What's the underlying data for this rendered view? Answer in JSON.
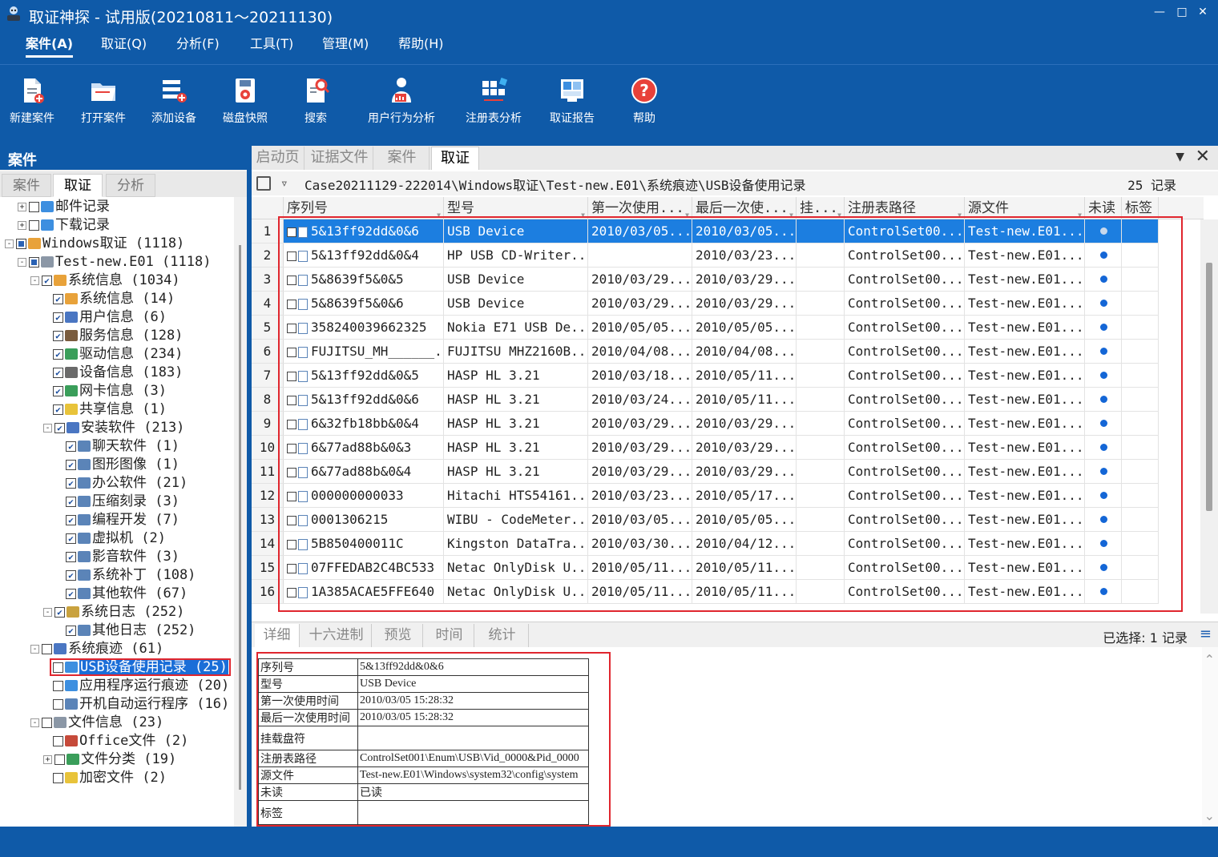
{
  "window": {
    "title": "取证神探 - 试用版(20210811～20211130)",
    "controls": [
      "minimize-icon",
      "maximize-icon",
      "close-icon"
    ]
  },
  "menu": [
    {
      "label": "案件(A)",
      "active": true
    },
    {
      "label": "取证(Q)"
    },
    {
      "label": "分析(F)"
    },
    {
      "label": "工具(T)"
    },
    {
      "label": "管理(M)"
    },
    {
      "label": "帮助(H)"
    }
  ],
  "toolbar": [
    {
      "label": "新建案件",
      "icon": "new-case-icon"
    },
    {
      "label": "打开案件",
      "icon": "open-folder-icon"
    },
    {
      "label": "添加设备",
      "icon": "add-device-icon"
    },
    {
      "label": "磁盘快照",
      "icon": "disk-snapshot-icon"
    },
    {
      "label": "搜索",
      "icon": "search-doc-icon"
    },
    {
      "label": "用户行为分析",
      "icon": "user-analysis-icon"
    },
    {
      "label": "注册表分析",
      "icon": "registry-icon"
    },
    {
      "label": "取证报告",
      "icon": "report-icon"
    },
    {
      "label": "帮助",
      "icon": "help-icon"
    }
  ],
  "left_panel": {
    "title": "案件",
    "tabs": [
      "案件",
      "取证",
      "分析"
    ],
    "active_tab": 1,
    "tree": [
      {
        "exp": "+",
        "chk": "none",
        "label": "邮件记录",
        "icon": "mail-icon"
      },
      {
        "exp": "+",
        "chk": "none",
        "label": "下载记录",
        "icon": "download-icon"
      },
      {
        "exp": "-",
        "chk": "part",
        "label": "Windows取证 (1118)",
        "icon": "windows-icon"
      },
      {
        "exp": "-",
        "chk": "part",
        "label": "Test-new.E01 (1118)",
        "icon": "disk-icon"
      },
      {
        "exp": "-",
        "chk": "check",
        "label": "系统信息 (1034)",
        "icon": "windows-icon"
      },
      {
        "exp": "",
        "chk": "check",
        "label": "系统信息 (14)",
        "icon": "windows-icon"
      },
      {
        "exp": "",
        "chk": "check",
        "label": "用户信息 (6)",
        "icon": "users-icon"
      },
      {
        "exp": "",
        "chk": "check",
        "label": "服务信息 (128)",
        "icon": "service-icon"
      },
      {
        "exp": "",
        "chk": "check",
        "label": "驱动信息 (234)",
        "icon": "driver-icon"
      },
      {
        "exp": "",
        "chk": "check",
        "label": "设备信息 (183)",
        "icon": "device-icon"
      },
      {
        "exp": "",
        "chk": "check",
        "label": "网卡信息 (3)",
        "icon": "nic-icon"
      },
      {
        "exp": "",
        "chk": "check",
        "label": "共享信息 (1)",
        "icon": "share-icon"
      },
      {
        "exp": "-",
        "chk": "check",
        "label": "安装软件 (213)",
        "icon": "software-icon"
      },
      {
        "exp": "",
        "chk": "check",
        "label": "聊天软件 (1)",
        "icon": "file-icon"
      },
      {
        "exp": "",
        "chk": "check",
        "label": "图形图像 (1)",
        "icon": "file-icon"
      },
      {
        "exp": "",
        "chk": "check",
        "label": "办公软件 (21)",
        "icon": "file-icon"
      },
      {
        "exp": "",
        "chk": "check",
        "label": "压缩刻录 (3)",
        "icon": "file-icon"
      },
      {
        "exp": "",
        "chk": "check",
        "label": "编程开发 (7)",
        "icon": "file-icon"
      },
      {
        "exp": "",
        "chk": "check",
        "label": "虚拟机 (2)",
        "icon": "file-icon"
      },
      {
        "exp": "",
        "chk": "check",
        "label": "影音软件 (3)",
        "icon": "file-icon"
      },
      {
        "exp": "",
        "chk": "check",
        "label": "系统补丁 (108)",
        "icon": "file-icon"
      },
      {
        "exp": "",
        "chk": "check",
        "label": "其他软件 (67)",
        "icon": "file-icon"
      },
      {
        "exp": "-",
        "chk": "check",
        "label": "系统日志 (252)",
        "icon": "log-icon"
      },
      {
        "exp": "",
        "chk": "check",
        "label": "其他日志 (252)",
        "icon": "file-icon"
      },
      {
        "exp": "-",
        "chk": "none",
        "label": "系统痕迹 (61)",
        "icon": "trace-icon"
      },
      {
        "exp": "",
        "chk": "none",
        "label": "USB设备使用记录 (25)",
        "icon": "usb-icon",
        "selected": true
      },
      {
        "exp": "",
        "chk": "none",
        "label": "应用程序运行痕迹 (20)",
        "icon": "app-icon"
      },
      {
        "exp": "",
        "chk": "none",
        "label": "开机自动运行程序 (16)",
        "icon": "startup-icon"
      },
      {
        "exp": "-",
        "chk": "none",
        "label": "文件信息 (23)",
        "icon": "files-icon"
      },
      {
        "exp": "",
        "chk": "none",
        "label": "Office文件 (2)",
        "icon": "office-icon"
      },
      {
        "exp": "+",
        "chk": "none",
        "label": "文件分类 (19)",
        "icon": "category-icon"
      },
      {
        "exp": "",
        "chk": "none",
        "label": "加密文件 (2)",
        "icon": "lock-icon"
      }
    ]
  },
  "doc_tabs": [
    "启动页",
    "证据文件",
    "案件",
    "取证"
  ],
  "doc_tab_active": 3,
  "path": {
    "text": "Case20211129-222014\\Windows取证\\Test-new.E01\\系统痕迹\\USB设备使用记录",
    "count": "25 记录"
  },
  "grid": {
    "columns": [
      "序列号",
      "型号",
      "第一次使用...",
      "最后一次使...",
      "挂...",
      "注册表路径",
      "源文件",
      "未读",
      "标签"
    ],
    "rows": [
      {
        "n": "1",
        "serial": "5&13ff92dd&0&6",
        "model": "USB Device",
        "first": "2010/03/05...",
        "last": "2010/03/05...",
        "reg": "ControlSet00...",
        "src": "Test-new.E01...",
        "selected": true
      },
      {
        "n": "2",
        "serial": "5&13ff92dd&0&4",
        "model": "HP USB CD-Writer...",
        "first": "",
        "last": "2010/03/23...",
        "reg": "ControlSet00...",
        "src": "Test-new.E01..."
      },
      {
        "n": "3",
        "serial": "5&8639f5&0&5",
        "model": "USB Device",
        "first": "2010/03/29...",
        "last": "2010/03/29...",
        "reg": "ControlSet00...",
        "src": "Test-new.E01..."
      },
      {
        "n": "4",
        "serial": "5&8639f5&0&6",
        "model": "USB Device",
        "first": "2010/03/29...",
        "last": "2010/03/29...",
        "reg": "ControlSet00...",
        "src": "Test-new.E01..."
      },
      {
        "n": "5",
        "serial": "358240039662325",
        "model": "Nokia E71 USB De...",
        "first": "2010/05/05...",
        "last": "2010/05/05...",
        "reg": "ControlSet00...",
        "src": "Test-new.E01..."
      },
      {
        "n": "6",
        "serial": "FUJITSU_MH______...",
        "model": "FUJITSU MHZ2160B...",
        "first": "2010/04/08...",
        "last": "2010/04/08...",
        "reg": "ControlSet00...",
        "src": "Test-new.E01..."
      },
      {
        "n": "7",
        "serial": "5&13ff92dd&0&5",
        "model": "HASP HL 3.21",
        "first": "2010/03/18...",
        "last": "2010/05/11...",
        "reg": "ControlSet00...",
        "src": "Test-new.E01..."
      },
      {
        "n": "8",
        "serial": "5&13ff92dd&0&6",
        "model": "HASP HL 3.21",
        "first": "2010/03/24...",
        "last": "2010/05/11...",
        "reg": "ControlSet00...",
        "src": "Test-new.E01..."
      },
      {
        "n": "9",
        "serial": "6&32fb18bb&0&4",
        "model": "HASP HL 3.21",
        "first": "2010/03/29...",
        "last": "2010/03/29...",
        "reg": "ControlSet00...",
        "src": "Test-new.E01..."
      },
      {
        "n": "10",
        "serial": "6&77ad88b&0&3",
        "model": "HASP HL 3.21",
        "first": "2010/03/29...",
        "last": "2010/03/29...",
        "reg": "ControlSet00...",
        "src": "Test-new.E01..."
      },
      {
        "n": "11",
        "serial": "6&77ad88b&0&4",
        "model": "HASP HL 3.21",
        "first": "2010/03/29...",
        "last": "2010/03/29...",
        "reg": "ControlSet00...",
        "src": "Test-new.E01..."
      },
      {
        "n": "12",
        "serial": "000000000033",
        "model": "Hitachi HTS54161...",
        "first": "2010/03/23...",
        "last": "2010/05/17...",
        "reg": "ControlSet00...",
        "src": "Test-new.E01..."
      },
      {
        "n": "13",
        "serial": "0001306215",
        "model": "WIBU - CodeMeter...",
        "first": "2010/03/05...",
        "last": "2010/05/05...",
        "reg": "ControlSet00...",
        "src": "Test-new.E01..."
      },
      {
        "n": "14",
        "serial": "5B850400011C",
        "model": "Kingston DataTra...",
        "first": "2010/03/30...",
        "last": "2010/04/12...",
        "reg": "ControlSet00...",
        "src": "Test-new.E01..."
      },
      {
        "n": "15",
        "serial": "07FFEDAB2C4BC533",
        "model": "Netac OnlyDisk U...",
        "first": "2010/05/11...",
        "last": "2010/05/11...",
        "reg": "ControlSet00...",
        "src": "Test-new.E01..."
      },
      {
        "n": "16",
        "serial": "1A385ACAE5FFE640",
        "model": "Netac OnlyDisk U...",
        "first": "2010/05/11...",
        "last": "2010/05/11...",
        "reg": "ControlSet00...",
        "src": "Test-new.E01..."
      }
    ]
  },
  "detail": {
    "tabs": [
      "详细",
      "十六进制",
      "预览",
      "时间",
      "统计"
    ],
    "active_tab": 0,
    "selected": "已选择: 1 记录",
    "props": [
      {
        "k": "序列号",
        "v": "5&13ff92dd&0&6"
      },
      {
        "k": "型号",
        "v": "USB Device"
      },
      {
        "k": "第一次使用时间",
        "v": "2010/03/05 15:28:32"
      },
      {
        "k": "最后一次使用时间",
        "v": "2010/03/05 15:28:32"
      },
      {
        "k": "挂载盘符",
        "v": "",
        "tall": true
      },
      {
        "k": "注册表路径",
        "v": "ControlSet001\\Enum\\USB\\Vid_0000&Pid_0000"
      },
      {
        "k": "源文件",
        "v": "Test-new.E01\\Windows\\system32\\config\\system"
      },
      {
        "k": "未读",
        "v": "已读"
      },
      {
        "k": "标签",
        "v": "",
        "tall": true
      }
    ]
  },
  "colors": {
    "chrome_blue": "#0f5aa8",
    "selection_blue": "#1c7ee0",
    "unread_dot": "#1466d6",
    "highlight_red": "#e0262e"
  }
}
